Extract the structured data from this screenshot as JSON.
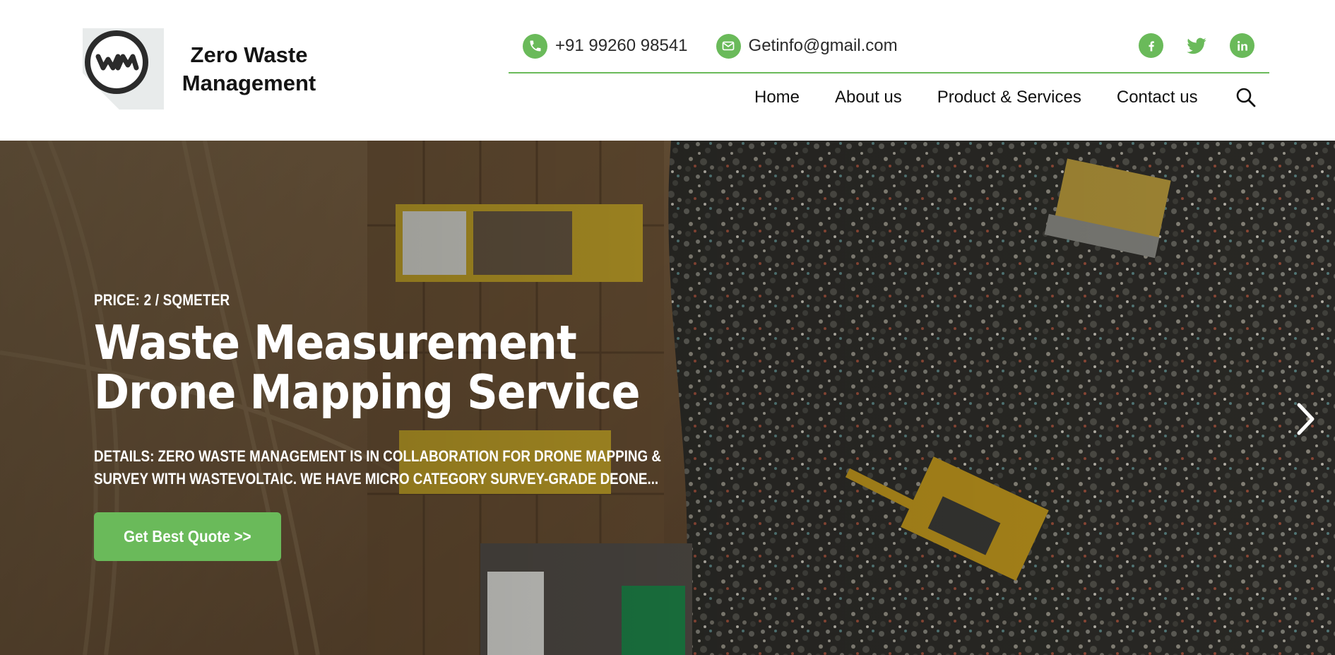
{
  "brand": {
    "logo_text": "Zero Waste Management",
    "logo_monogram": "WM",
    "accent": "#6aba5a"
  },
  "contact": {
    "phone": "+91 99260 98541",
    "email": "Getinfo@gmail.com",
    "phone_icon": "phone-icon",
    "email_icon": "mail-icon"
  },
  "social": [
    {
      "name": "facebook-icon"
    },
    {
      "name": "twitter-icon"
    },
    {
      "name": "linkedin-icon"
    }
  ],
  "nav": {
    "items": [
      {
        "label": "Home"
      },
      {
        "label": "About us"
      },
      {
        "label": "Product & Services"
      },
      {
        "label": "Contact us"
      }
    ],
    "search_icon": "search-icon"
  },
  "hero": {
    "price": "PRICE: 2 / SQMETER",
    "title_line1": "Waste Measurement",
    "title_line2": "Drone Mapping Service",
    "details_line1": "DETAILS: ZERO WASTE MANAGEMENT IS IN COLLABORATION FOR DRONE MAPPING &",
    "details_line2": "SURVEY WITH WASTEVOLTAIC. WE HAVE MICRO CATEGORY SURVEY-GRADE DEONE...",
    "cta_label": "Get Best Quote >>",
    "next_icon": "chevron-right-icon"
  }
}
